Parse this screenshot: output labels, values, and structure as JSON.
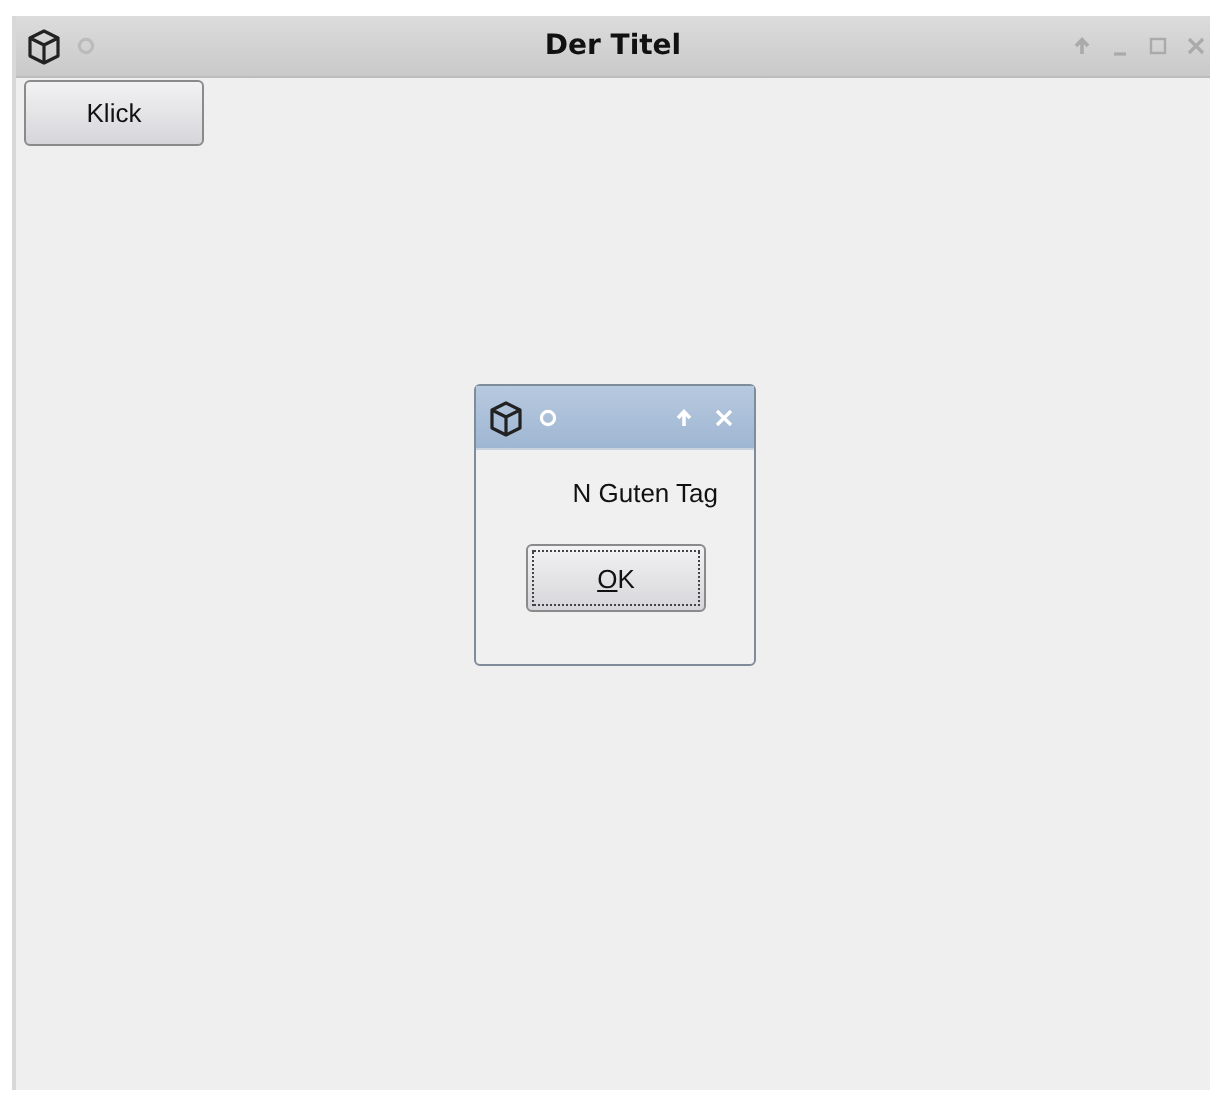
{
  "window": {
    "title": "Der Titel"
  },
  "main": {
    "button": "Klick"
  },
  "dialog": {
    "message": "N Guten Tag",
    "ok_button": {
      "mnemonic": "O",
      "rest": "K",
      "focused": true
    }
  }
}
